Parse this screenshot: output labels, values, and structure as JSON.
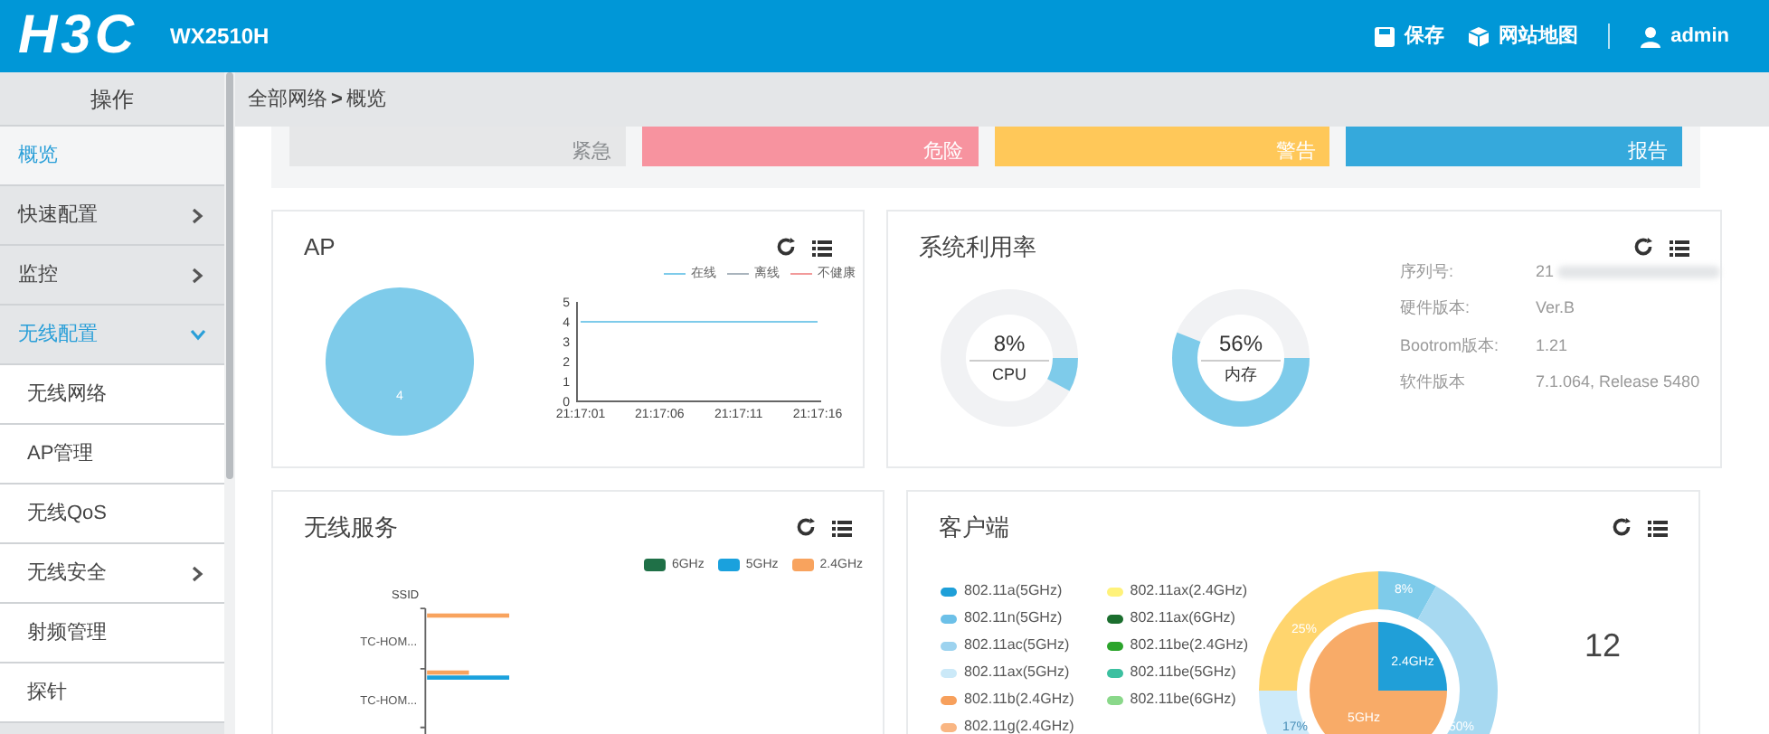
{
  "header": {
    "logo": "H3C",
    "model": "WX2510H",
    "actions": [
      {
        "kind": "save",
        "label": "保存"
      },
      {
        "kind": "sitemap",
        "label": "网站地图"
      },
      {
        "kind": "user",
        "label": "admin"
      }
    ]
  },
  "sidebar": {
    "title": "操作",
    "items": [
      {
        "label": "概览",
        "selected": true,
        "expandable": false,
        "expanded": false
      },
      {
        "label": "快速配置",
        "selected": false,
        "expandable": true,
        "expanded": false
      },
      {
        "label": "监控",
        "selected": false,
        "expandable": true,
        "expanded": false
      },
      {
        "label": "无线配置",
        "selected": false,
        "expandable": true,
        "expanded": true,
        "children": [
          {
            "label": "无线网络",
            "expandable": false
          },
          {
            "label": "AP管理",
            "expandable": false
          },
          {
            "label": "无线QoS",
            "expandable": false
          },
          {
            "label": "无线安全",
            "expandable": true
          },
          {
            "label": "射频管理",
            "expandable": false
          },
          {
            "label": "探针",
            "expandable": false
          }
        ]
      }
    ]
  },
  "breadcrumb": {
    "items": [
      "全部网络",
      "概览"
    ],
    "separator": ">"
  },
  "alerts": [
    {
      "label": "紧急",
      "color": "#e6e7e8"
    },
    {
      "label": "危险",
      "color": "#f7939f"
    },
    {
      "label": "警告",
      "color": "#ffc859"
    },
    {
      "label": "报告",
      "color": "#35a9dc"
    }
  ],
  "ap_panel": {
    "title": "AP",
    "pie": {
      "chart_data": {
        "type": "pie",
        "values": [
          4
        ],
        "data_labels": true
      }
    },
    "line": {
      "chart_data": {
        "type": "line",
        "legend": "top-right",
        "x": [
          "21:17:01",
          "21:17:06",
          "21:17:11",
          "21:17:16"
        ],
        "ylim": [
          0,
          5
        ],
        "yticks": [
          0,
          1,
          2,
          3,
          4,
          5
        ],
        "series": [
          {
            "name": "在线",
            "color": "#7ecbea",
            "values": [
              4,
              4,
              4,
              4
            ]
          },
          {
            "name": "离线",
            "color": "#a9b4bd",
            "values": [
              null,
              null,
              null,
              null
            ]
          },
          {
            "name": "不健康",
            "color": "#f29a9a",
            "values": [
              null,
              null,
              null,
              null
            ]
          }
        ]
      }
    }
  },
  "system_panel": {
    "title": "系统利用率",
    "gauges": [
      {
        "value": "8%",
        "label": "CPU",
        "level": 0.08
      },
      {
        "value": "56%",
        "label": "内存",
        "level": 0.56
      }
    ],
    "info": [
      {
        "label": "序列号:",
        "value": "21",
        "blurred": true
      },
      {
        "label": "硬件版本:",
        "value": "Ver.B",
        "blurred": false
      },
      {
        "label": "Bootrom版本:",
        "value": "1.21",
        "blurred": false
      },
      {
        "label": "软件版本",
        "value": "7.1.064, Release 5480",
        "blurred": false
      }
    ]
  },
  "wireless_panel": {
    "title": "无线服务",
    "legend": [
      {
        "name": "6GHz",
        "color": "#1f7047"
      },
      {
        "name": "5GHz",
        "color": "#1aa1dd"
      },
      {
        "name": "2.4GHz",
        "color": "#f8a35e"
      }
    ],
    "axis_title": "SSID",
    "categories": [
      "TC-HOM...",
      "TC-HOM..."
    ]
  },
  "client_panel": {
    "title": "客户端",
    "legend": [
      {
        "name": "802.11a(5GHz)",
        "color": "#1e9fd8"
      },
      {
        "name": "802.11n(5GHz)",
        "color": "#6cc0e8"
      },
      {
        "name": "802.11ac(5GHz)",
        "color": "#9dd3ef"
      },
      {
        "name": "802.11ax(5GHz)",
        "color": "#cbe9f8"
      },
      {
        "name": "802.11b(2.4GHz)",
        "color": "#f7a05c"
      },
      {
        "name": "802.11g(2.4GHz)",
        "color": "#f9b683"
      },
      {
        "name": "802.11ax(2.4GHz)",
        "color": "#fff27a"
      },
      {
        "name": "802.11ax(6GHz)",
        "color": "#1b6e2e"
      },
      {
        "name": "802.11be(2.4GHz)",
        "color": "#2ba42b"
      },
      {
        "name": "802.11be(5GHz)",
        "color": "#3cc0a0"
      },
      {
        "name": "802.11be(6GHz)",
        "color": "#8ad88a"
      }
    ],
    "outer_labels": [
      "8%",
      "50%",
      "17%",
      "25%"
    ],
    "inner_labels": [
      "2.4GHz",
      "5GHz"
    ],
    "count": "12"
  }
}
